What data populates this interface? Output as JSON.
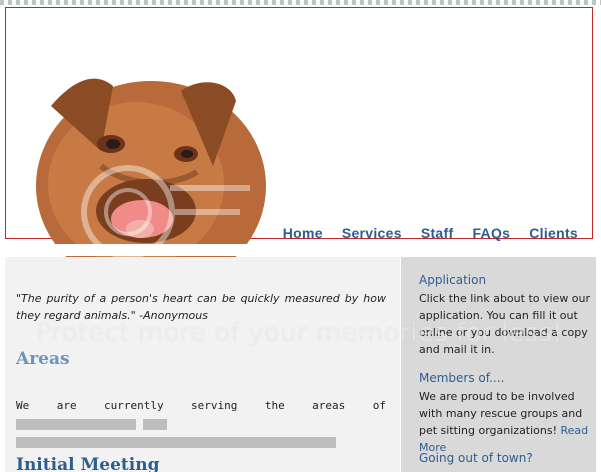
{
  "nav": {
    "items": [
      {
        "label": "Home"
      },
      {
        "label": "Services"
      },
      {
        "label": "Staff"
      },
      {
        "label": "FAQs"
      },
      {
        "label": "Clients"
      }
    ]
  },
  "main": {
    "quote": "\"The purity of a person's heart can be quickly measured by how they regard animals.\" -Anonymous",
    "areas_heading": "Areas",
    "areas_text_start": "We are currently serving the areas of",
    "initial_heading": "Initial Meeting"
  },
  "sidebar": {
    "application_heading": "Application",
    "application_text": "Click the link about to view our application. You can fill it out online or you download a copy and mail it in.",
    "members_heading": "Members of....",
    "members_text": "We are proud to be involved with many rescue groups and pet sitting organizations!",
    "read_more": "Read More",
    "out_of_town_heading": "Going out of town?"
  },
  "watermark": {
    "text": "Protect more of your memories for less!"
  },
  "colors": {
    "nav": "#2e5d92",
    "header_border": "#c0272d",
    "sidebar_bg": "#d9d9d9",
    "main_bg": "#f2f2f2"
  }
}
